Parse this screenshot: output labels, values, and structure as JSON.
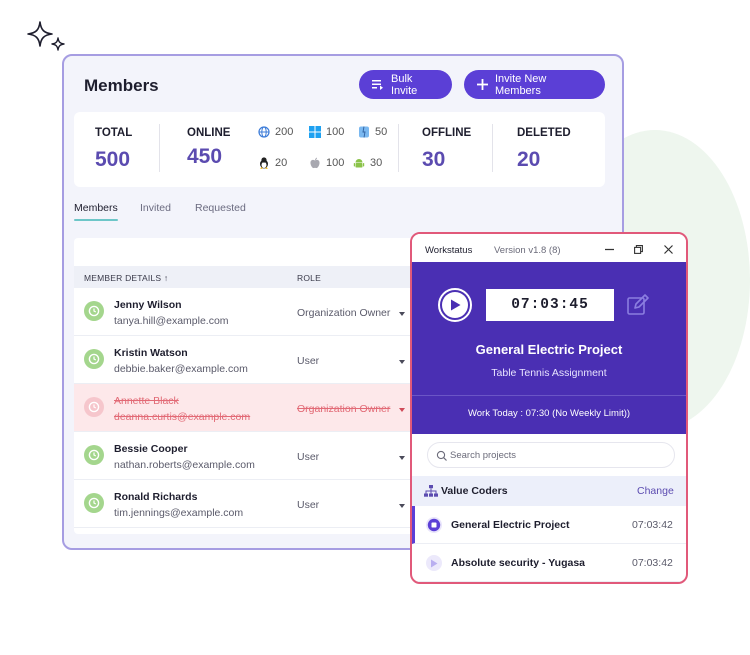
{
  "members_panel": {
    "title": "Members",
    "bulk_invite_label": "Bulk Invite",
    "invite_new_label": "Invite New Members",
    "accent_color": "#5b3fd6",
    "stats": {
      "total": {
        "label": "TOTAL",
        "value": "500"
      },
      "online": {
        "label": "ONLINE",
        "value": "450"
      },
      "offline": {
        "label": "OFFLINE",
        "value": "30"
      },
      "deleted": {
        "label": "DELETED",
        "value": "20"
      }
    },
    "online_breakdown": [
      {
        "os": "web-icon",
        "count": "200"
      },
      {
        "os": "windows-icon",
        "count": "100"
      },
      {
        "os": "mac-icon",
        "count": "50"
      },
      {
        "os": "linux-icon",
        "count": "20"
      },
      {
        "os": "apple-icon",
        "count": "100"
      },
      {
        "os": "android-icon",
        "count": "30"
      }
    ],
    "tabs": [
      {
        "label": "Members",
        "active": true
      },
      {
        "label": "Invited",
        "active": false
      },
      {
        "label": "Requested",
        "active": false
      }
    ],
    "columns": {
      "member_details": "MEMBER DETAILS",
      "sort_arrow": "↑",
      "role": "ROLE"
    },
    "rows": [
      {
        "name": "Jenny Wilson",
        "email": "tanya.hill@example.com",
        "role": "Organization Owner",
        "deleted": false
      },
      {
        "name": "Kristin Watson",
        "email": "debbie.baker@example.com",
        "role": "User",
        "deleted": false
      },
      {
        "name": "Annette Black",
        "email": "deanna.curtis@example.com",
        "role": "Organization Owner",
        "deleted": true
      },
      {
        "name": "Bessie Cooper",
        "email": "nathan.roberts@example.com",
        "role": "User",
        "deleted": false
      },
      {
        "name": "Ronald Richards",
        "email": "tim.jennings@example.com",
        "role": "User",
        "deleted": false
      }
    ]
  },
  "workstatus": {
    "app_name": "Workstatus",
    "version": "Version v1.8 (8)",
    "timer": "07:03:45",
    "project": "General Electric Project",
    "task": "Table Tennis Assignment",
    "work_today": "Work Today : 07:30 (No Weekly Limit))",
    "search_placeholder": "Search projects",
    "org_name": "Value Coders",
    "change_label": "Change",
    "brand_color": "#4a2fb3",
    "projects": [
      {
        "name": "General Electric Project",
        "time": "07:03:42",
        "active": true
      },
      {
        "name": "Absolute security - Yugasa",
        "time": "07:03:42",
        "active": false
      }
    ]
  }
}
